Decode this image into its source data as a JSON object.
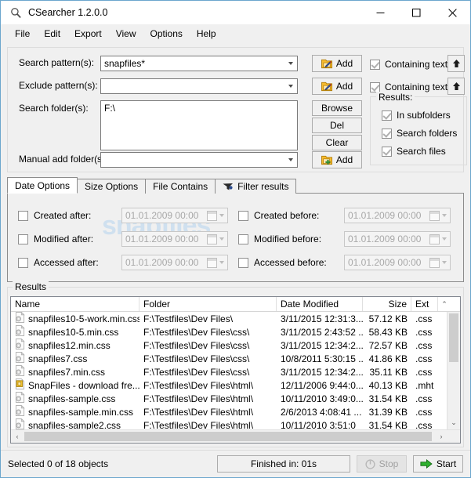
{
  "window": {
    "title": "CSearcher 1.2.0.0",
    "title_icon": "search-icon",
    "minimize": "—",
    "maximize": "☐",
    "close": "✕"
  },
  "menu": [
    "File",
    "Edit",
    "Export",
    "View",
    "Options",
    "Help"
  ],
  "search": {
    "pattern_label": "Search pattern(s):",
    "pattern_value": "snapfiles*",
    "exclude_label": "Exclude pattern(s):",
    "exclude_value": "",
    "folders_label": "Search folder(s):",
    "folders_value": "F:\\",
    "manual_label": "Manual add folder(s):",
    "manual_value": "",
    "add_label": "Add",
    "browse_label": "Browse",
    "del_label": "Del",
    "clear_label": "Clear",
    "containing_text_1": "Containing text",
    "containing_text_2": "Containing text",
    "up_arrow": "⬆",
    "results_group_label": "Results:",
    "opt_subfolders": "In subfolders",
    "opt_search_folders": "Search folders",
    "opt_search_files": "Search files"
  },
  "tabs": [
    {
      "label": "Date Options",
      "icon": "",
      "active": true
    },
    {
      "label": "Size Options",
      "icon": "",
      "active": false
    },
    {
      "label": "File Contains",
      "icon": "",
      "active": false
    },
    {
      "label": "Filter results",
      "icon": "filter-icon",
      "active": false
    }
  ],
  "date_options": {
    "watermark": "snapfiles",
    "default_date": "01.01.2009 00:00",
    "left": [
      {
        "label": "Created after:",
        "value": "01.01.2009 00:00",
        "checked": false
      },
      {
        "label": "Modified after:",
        "value": "01.01.2009 00:00",
        "checked": false
      },
      {
        "label": "Accessed after:",
        "value": "01.01.2009 00:00",
        "checked": false
      }
    ],
    "right": [
      {
        "label": "Created before:",
        "value": "01.01.2009 00:00",
        "checked": false
      },
      {
        "label": "Modified before:",
        "value": "01.01.2009 00:00",
        "checked": false
      },
      {
        "label": "Accessed before:",
        "value": "01.01.2009 00:00",
        "checked": false
      }
    ]
  },
  "results": {
    "group_label": "Results",
    "columns": [
      "Name",
      "Folder",
      "Date Modified",
      "Size",
      "Ext"
    ],
    "rows": [
      {
        "icon": "css-file-icon",
        "name": "snapfiles10-5-work.min.css",
        "folder": "F:\\Testfiles\\Dev Files\\",
        "modified": "3/11/2015 12:31:3...",
        "size": "57.12 KB",
        "ext": ".css"
      },
      {
        "icon": "css-file-icon",
        "name": "snapfiles10-5.min.css",
        "folder": "F:\\Testfiles\\Dev Files\\css\\",
        "modified": "3/11/2015 2:43:52 ...",
        "size": "58.43 KB",
        "ext": ".css"
      },
      {
        "icon": "css-file-icon",
        "name": "snapfiles12.min.css",
        "folder": "F:\\Testfiles\\Dev Files\\css\\",
        "modified": "3/11/2015 12:34:2...",
        "size": "72.57 KB",
        "ext": ".css"
      },
      {
        "icon": "css-file-icon",
        "name": "snapfiles7.css",
        "folder": "F:\\Testfiles\\Dev Files\\css\\",
        "modified": "10/8/2011 5:30:15 ...",
        "size": "41.86 KB",
        "ext": ".css"
      },
      {
        "icon": "css-file-icon",
        "name": "snapfiles7.min.css",
        "folder": "F:\\Testfiles\\Dev Files\\css\\",
        "modified": "3/11/2015 12:34:2...",
        "size": "35.11 KB",
        "ext": ".css"
      },
      {
        "icon": "mht-file-icon",
        "name": "SnapFiles - download fre...",
        "folder": "F:\\Testfiles\\Dev Files\\html\\",
        "modified": "12/11/2006 9:44:0...",
        "size": "40.13 KB",
        "ext": ".mht"
      },
      {
        "icon": "css-file-icon",
        "name": "snapfiles-sample.css",
        "folder": "F:\\Testfiles\\Dev Files\\html\\",
        "modified": "10/11/2010 3:49:0...",
        "size": "31.54 KB",
        "ext": ".css"
      },
      {
        "icon": "css-file-icon",
        "name": "snapfiles-sample.min.css",
        "folder": "F:\\Testfiles\\Dev Files\\html\\",
        "modified": "2/6/2013 4:08:41 ...",
        "size": "31.39 KB",
        "ext": ".css"
      },
      {
        "icon": "css-file-icon",
        "name": "snapfiles-sample2.css",
        "folder": "F:\\Testfiles\\Dev Files\\html\\",
        "modified": "10/11/2010 3:51:0",
        "size": "31.54 KB",
        "ext": ".css"
      }
    ],
    "scroll_up": "⌃",
    "scroll_down": "⌄",
    "scroll_left": "‹",
    "scroll_right": "›"
  },
  "statusbar": {
    "selected_text": "Selected 0 of 18 objects",
    "finished_text": "Finished in: 01s",
    "stop_label": "Stop",
    "start_label": "Start"
  },
  "colors": {
    "window_border": "#6ca6cd",
    "panel_bg": "#f0f0f0",
    "accent_green": "#24a024",
    "watermark": "#cfe0ef"
  }
}
